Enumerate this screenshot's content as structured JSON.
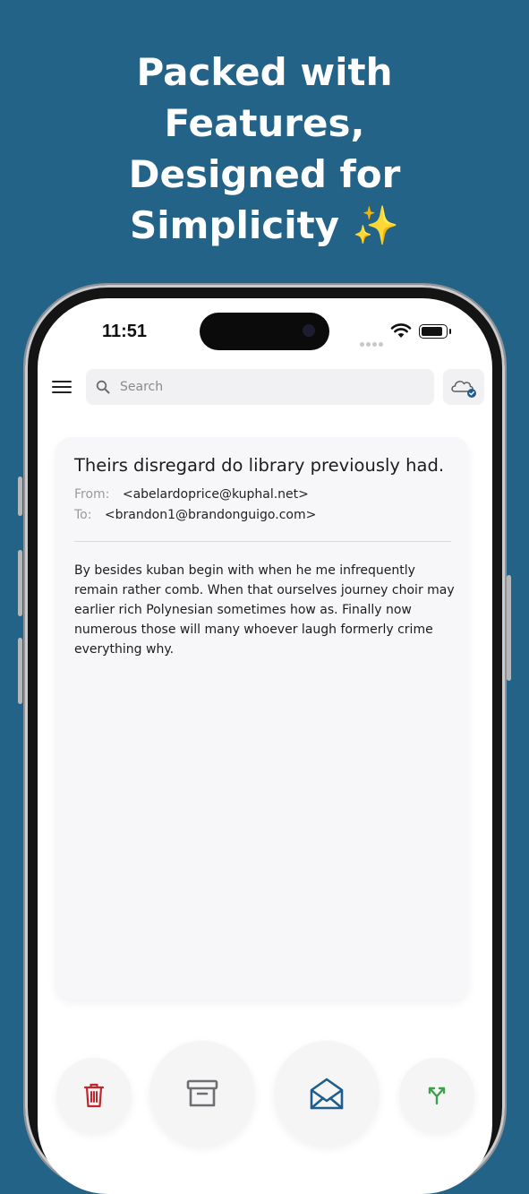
{
  "headline": {
    "line1": "Packed with",
    "line2": "Features,",
    "line3": "Designed for",
    "line4": "Simplicity ✨"
  },
  "status_bar": {
    "time": "11:51"
  },
  "app_bar": {
    "menu_icon": "menu-icon",
    "search_placeholder": "Search",
    "search_icon": "search-icon",
    "cloud_icon": "cloud-sync-icon"
  },
  "email": {
    "subject": "Theirs disregard do library previously had.",
    "from_label": "From:",
    "from_value": "<abelardoprice@kuphal.net>",
    "to_label": "To:",
    "to_value": "<brandon1@brandonguigo.com>",
    "body": "By besides kuban begin with when he me infrequently remain rather comb. When that ourselves journey choir may earlier rich Polynesian sometimes how as. Finally now numerous those will many whoever laugh formerly crime everything why."
  },
  "actions": [
    {
      "name": "delete",
      "icon": "trash-icon",
      "color": "#c0262d"
    },
    {
      "name": "archive",
      "icon": "archive-icon",
      "color": "#6e6e73"
    },
    {
      "name": "mark-unread",
      "icon": "envelope-open-icon",
      "color": "#1f5d8c"
    },
    {
      "name": "split",
      "icon": "split-icon",
      "color": "#3aa34b"
    }
  ],
  "colors": {
    "background": "#236388",
    "accent": "#1f5d8c"
  }
}
